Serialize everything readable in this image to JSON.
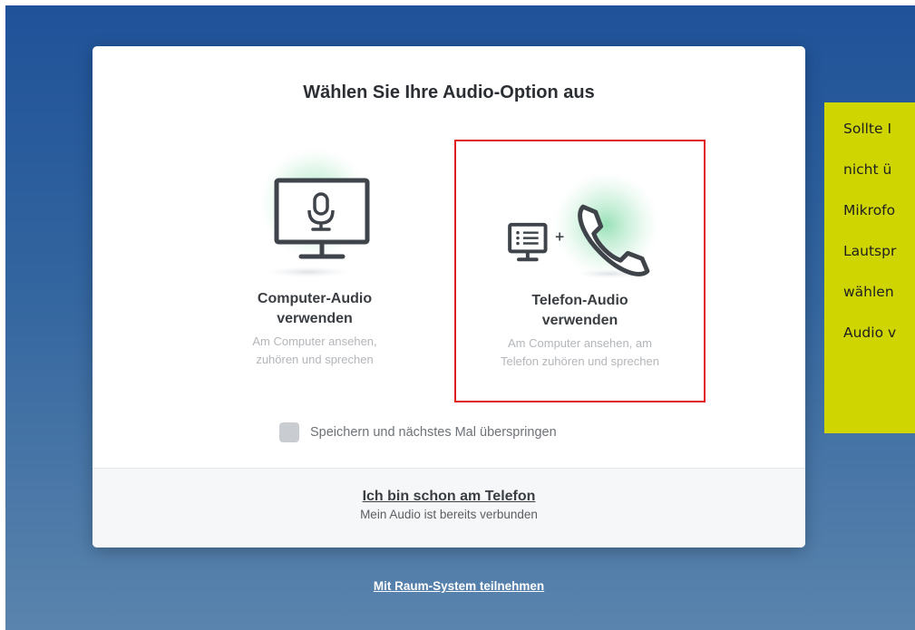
{
  "dialog": {
    "title": "Wählen Sie Ihre Audio-Option aus",
    "options": [
      {
        "title_lines": [
          "Computer-Audio",
          "verwenden"
        ],
        "desc_lines": [
          "Am Computer ansehen,",
          "zuhören und sprechen"
        ],
        "icon": "computer-monitor-microphone"
      },
      {
        "title_lines": [
          "Telefon-Audio",
          "verwenden"
        ],
        "desc_lines": [
          "Am Computer ansehen, am",
          "Telefon zuhören und sprechen"
        ],
        "icon": "monitor-plus-phone",
        "highlighted": true,
        "highlight_color": "#e01e1e"
      }
    ],
    "remember_label": "Speichern und nächstes Mal überspringen",
    "remember_checked": false,
    "footer": {
      "link": "Ich bin schon am Telefon",
      "sub": "Mein Audio ist bereits verbunden"
    }
  },
  "room_link": "Mit Raum-System teilnehmen",
  "callout": {
    "background": "#cfd500",
    "lines": [
      "Sollte I",
      "nicht ü",
      "Mikrofo",
      "Lautspr",
      "wählen",
      "Audio v"
    ]
  },
  "colors": {
    "backdrop_top": "#1f5299",
    "backdrop_bottom": "#5a84ad",
    "icon_stroke": "#3f444a",
    "icon_glow": "#7ed9a4"
  }
}
